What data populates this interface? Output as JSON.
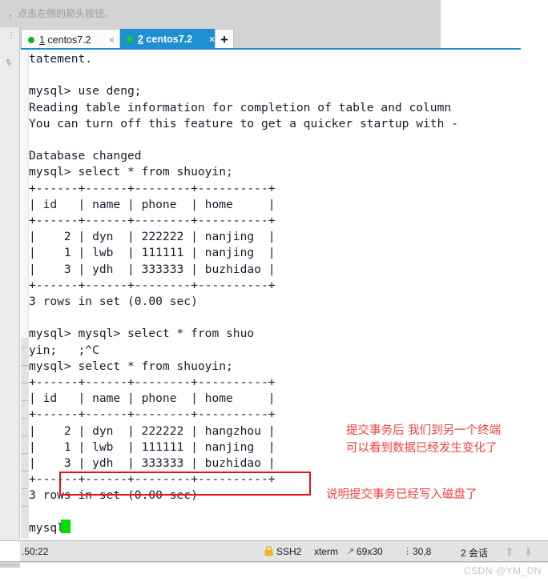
{
  "window": {
    "top_hint": "，点击左侧的箭头按钮。",
    "gutter_dots": "⋮"
  },
  "tabs": {
    "items": [
      {
        "index": "1",
        "label": " centos7.2",
        "active": false,
        "status_dot": "green-dot",
        "close_glyph": "×"
      },
      {
        "index": "2",
        "label": " centos7.2",
        "active": true,
        "status_dot": "green-dot",
        "close_glyph": "×"
      }
    ],
    "add_label": "+"
  },
  "terminal": {
    "content": "tatement.\n\nmysql> use deng;\nReading table information for completion of table and column\nYou can turn off this feature to get a quicker startup with -\n\nDatabase changed\nmysql> select * from shuoyin;\n+------+------+--------+----------+\n| id   | name | phone  | home     |\n+------+------+--------+----------+\n|    2 | dyn  | 222222 | nanjing  |\n|    1 | lwb  | 111111 | nanjing  |\n|    3 | ydh  | 333333 | buzhidao |\n+------+------+--------+----------+\n3 rows in set (0.00 sec)\n\nmysql> mysql> select * from shuo\nyin;   ;^C\nmysql> select * from shuoyin;\n+------+------+--------+----------+\n| id   | name | phone  | home     |\n+------+------+--------+----------+\n|    2 | dyn  | 222222 | hangzhou |\n|    1 | lwb  | 111111 | nanjing  |\n|    3 | ydh  | 333333 | buzhidao |\n+------+------+--------+----------+\n3 rows in set (0.00 sec)\n\nmysql> ",
    "prompt": "mysql>",
    "cursor": "block-cursor",
    "side_rail_icon": "pen-icon"
  },
  "annotations": {
    "highlight_box_label": "highlighted-row",
    "note_line_1": "提交事务后 我们到另一个终端",
    "note_line_2": "可以看到数据已经发生变化了",
    "note_line_3": "说明提交事务已经写入磁盘了",
    "color": "#f4413f"
  },
  "statusbar": {
    "address": ".50:22",
    "ssh": "SSH2",
    "terminal_type": "xterm",
    "size": "69x30",
    "position": "30,8",
    "sessions": "2 会话",
    "lock_icon": "lock-icon",
    "size_icon": "resize-icon",
    "pos_icon": "caret-position-icon",
    "arrows": "⬆ ⬇"
  },
  "watermark": {
    "text": "CSDN @YM_DN"
  }
}
